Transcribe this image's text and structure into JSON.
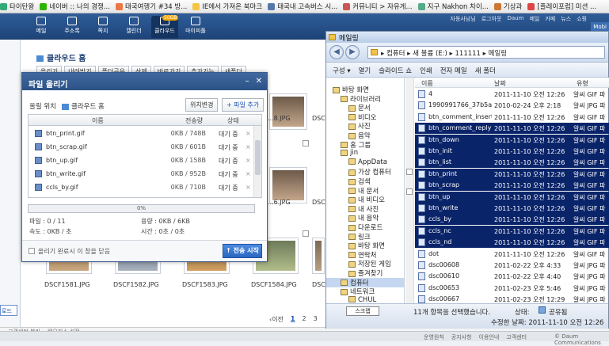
{
  "bookmarks": [
    {
      "label": "타이탄왕",
      "color": "#3a7"
    },
    {
      "label": "네이버 :: 나의 경쟁...",
      "color": "#2db400"
    },
    {
      "label": "태국여행기 #34 방...",
      "color": "#e74"
    },
    {
      "label": "IE에서 가져온 북마크",
      "color": "#f4c542"
    },
    {
      "label": "태국내 고속버스 시...",
      "color": "#57a"
    },
    {
      "label": "커뮤니티 > 자유게...",
      "color": "#c55"
    },
    {
      "label": "지구 Nakhon 차이...",
      "color": "#5a8"
    },
    {
      "label": "기상과",
      "color": "#c73"
    },
    {
      "label": "[플레이포럼] 미션 ...",
      "color": "#d44"
    }
  ],
  "mailbar": {
    "tabs": [
      {
        "label": "메일",
        "active": false
      },
      {
        "label": "주소록",
        "active": false
      },
      {
        "label": "쪽지",
        "active": false
      },
      {
        "label": "캘린더",
        "active": false
      },
      {
        "label": "클라우드",
        "active": true,
        "badge": "50GB"
      },
      {
        "label": "마이피플",
        "active": false
      }
    ],
    "toplinks": [
      "자동사남님",
      "로그아웃",
      "Daum",
      "메일",
      "카페",
      "뉴스",
      "쇼핑"
    ],
    "logo": "Mobi"
  },
  "page": {
    "breadcrumb": "클라우드 홈",
    "toolbar": [
      "올리기",
      "내려받기",
      "폴더공유",
      "삭제",
      "바로가기",
      "추가기능",
      "새폴더"
    ],
    "photos": [
      {
        "label": "DSCF1581.JPG"
      },
      {
        "label": "DSCF1582.JPG"
      },
      {
        "label": "DSCF1583.JPG"
      },
      {
        "label": "DSCF1584.JPG"
      }
    ],
    "right_labels": [
      "...8.JPG",
      "DSC",
      "...6.JPG",
      "DSC",
      "DSC"
    ],
    "pager": {
      "prev": "‹이전",
      "pages": [
        "1",
        "2",
        "3"
      ],
      "current": "1"
    },
    "footer_left": "로드",
    "bottombar_left": "고객센터 분리",
    "bottombar_mid": "웹오피스 설정",
    "footer_links": [
      "운영원칙",
      "공지사항",
      "이용안내",
      "고객센터"
    ],
    "copyright": "© Daum Communications"
  },
  "upload_dialog": {
    "title": "파일 올리기",
    "location_label": "올릴 위치",
    "location_value": "클라우드 홈",
    "change_location": "위치변경",
    "add_file": "+ 파일 추가",
    "columns": [
      "이름",
      "전송량",
      "상태"
    ],
    "files": [
      {
        "name": "btn_print.gif",
        "size": "0KB / 748B",
        "status": "대기 중"
      },
      {
        "name": "btn_scrap.gif",
        "size": "0KB / 601B",
        "status": "대기 중"
      },
      {
        "name": "btn_up.gif",
        "size": "0KB / 158B",
        "status": "대기 중"
      },
      {
        "name": "btn_write.gif",
        "size": "0KB / 952B",
        "status": "대기 중"
      },
      {
        "name": "ccls_by.gif",
        "size": "0KB / 710B",
        "status": "대기 중"
      }
    ],
    "progress": {
      "percent": 0,
      "label": "0%"
    },
    "stats": {
      "files": "파일 : 0 / 11",
      "capacity": "용량 : 0KB / 6KB",
      "speed": "속도 : 0KB / 초",
      "time": "시간 : 0초 / 0초"
    },
    "close_on_complete": "올리기 완료시 이 창을 닫음",
    "start": "↑ 전송 시작"
  },
  "explorer": {
    "title": "메일링",
    "address": "▸ 컴퓨터 ▸ 새 볼륨 (E:) ▸ 111111 ▸ 메일링",
    "menu": [
      "구성 ▾",
      "열기",
      "슬라이드 쇼",
      "인쇄",
      "전자 메일",
      "새 폴더"
    ],
    "nav": [
      {
        "label": "바탕 화면",
        "indent": 0
      },
      {
        "label": "라이브러리",
        "indent": 1
      },
      {
        "label": "문서",
        "indent": 2
      },
      {
        "label": "비디오",
        "indent": 2
      },
      {
        "label": "사진",
        "indent": 2
      },
      {
        "label": "음악",
        "indent": 2
      },
      {
        "label": "홈 그룹",
        "indent": 1
      },
      {
        "label": "jin",
        "indent": 1
      },
      {
        "label": "AppData",
        "indent": 2
      },
      {
        "label": "가상 컴퓨터",
        "indent": 2
      },
      {
        "label": "검색",
        "indent": 2
      },
      {
        "label": "내 문서",
        "indent": 2
      },
      {
        "label": "내 비디오",
        "indent": 2
      },
      {
        "label": "내 사진",
        "indent": 2
      },
      {
        "label": "내 음악",
        "indent": 2
      },
      {
        "label": "다운로드",
        "indent": 2
      },
      {
        "label": "링크",
        "indent": 2
      },
      {
        "label": "바탕 화면",
        "indent": 2
      },
      {
        "label": "연락처",
        "indent": 2
      },
      {
        "label": "저장된 게임",
        "indent": 2
      },
      {
        "label": "즐겨찾기",
        "indent": 2
      },
      {
        "label": "컴퓨터",
        "indent": 1,
        "selected": true
      },
      {
        "label": "네트워크",
        "indent": 1
      },
      {
        "label": "CHUL",
        "indent": 2
      }
    ],
    "columns": [
      "이름",
      "날짜",
      "유형"
    ],
    "files": [
      {
        "name": "4",
        "date": "2011-11-10 오전 12:26",
        "type": "알씨 GIF 파",
        "selected": false
      },
      {
        "name": "1990991766_37b5a...",
        "date": "2010-02-24 오후 2:18",
        "type": "알씨 JPG 파",
        "selected": false
      },
      {
        "name": "btn_comment_insert",
        "date": "2011-11-10 오전 12:26",
        "type": "알씨 GIF 파",
        "selected": false
      },
      {
        "name": "btn_comment_reply",
        "date": "2011-11-10 오전 12:26",
        "type": "알씨 GIF 파",
        "selected": true
      },
      {
        "name": "btn_down",
        "date": "2011-11-10 오전 12:26",
        "type": "알씨 GIF 파",
        "selected": true
      },
      {
        "name": "btn_init",
        "date": "2011-11-10 오전 12:26",
        "type": "알씨 GIF 파",
        "selected": true
      },
      {
        "name": "btn_list",
        "date": "2011-11-10 오전 12:26",
        "type": "알씨 GIF 파",
        "selected": true
      },
      {
        "name": "btn_print",
        "date": "2011-11-10 오전 12:26",
        "type": "알씨 GIF 파",
        "selected": true
      },
      {
        "name": "btn_scrap",
        "date": "2011-11-10 오전 12:26",
        "type": "알씨 GIF 파",
        "selected": true
      },
      {
        "name": "btn_up",
        "date": "2011-11-10 오전 12:26",
        "type": "알씨 GIF 파",
        "selected": true
      },
      {
        "name": "btn_write",
        "date": "2011-11-10 오전 12:26",
        "type": "알씨 GIF 파",
        "selected": true
      },
      {
        "name": "ccls_by",
        "date": "2011-11-10 오전 12:26",
        "type": "알씨 GIF 파",
        "selected": true
      },
      {
        "name": "ccls_nc",
        "date": "2011-11-10 오전 12:26",
        "type": "알씨 GIF 파",
        "selected": true
      },
      {
        "name": "ccls_nd",
        "date": "2011-11-10 오전 12:26",
        "type": "알씨 GIF 파",
        "selected": true
      },
      {
        "name": "dot",
        "date": "2011-11-10 오전 12:26",
        "type": "알씨 GIF 파",
        "selected": false
      },
      {
        "name": "dsc00608",
        "date": "2011-02-22 오후 4:33",
        "type": "알씨 JPG 파",
        "selected": false
      },
      {
        "name": "dsc00610",
        "date": "2011-02-22 오후 4:40",
        "type": "알씨 JPG 파",
        "selected": false
      },
      {
        "name": "dsc00653",
        "date": "2011-02-23 오후 5:46",
        "type": "알씨 JPG 파",
        "selected": false
      },
      {
        "name": "dsc00667",
        "date": "2011-02-23 오전 12:29",
        "type": "알씨 JPG 파",
        "selected": false
      }
    ],
    "status": {
      "search": "스크랩",
      "summary": "11개 항목을 선택했습니다.",
      "state_label": "상태:",
      "state_value": "공유됨",
      "modified": "수정한 날짜: 2011-11-10 오전 12:26"
    }
  }
}
